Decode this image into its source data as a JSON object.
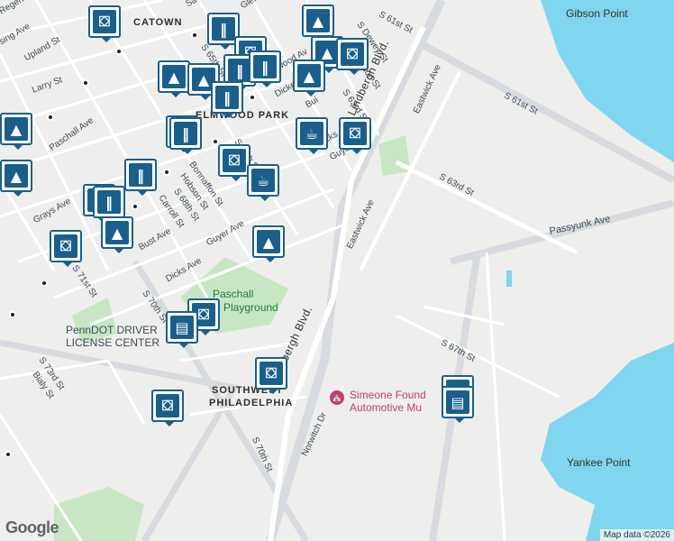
{
  "map": {
    "colors": {
      "land": "#eeeeec",
      "water": "#7fd6ee",
      "park": "#c8e6c4",
      "road": "#ffffff",
      "highway": "#d7dade",
      "marker": "#1a5f8c",
      "poi": "#c43c7a"
    },
    "labels": {
      "gibson_point": "Gibson Point",
      "yankee_point": "Yankee Point",
      "elmwood_park": "ELMWOOD PARK",
      "southwest_philadelphia_1": "SOUTHWEST",
      "southwest_philadelphia_2": "PHILADELPHIA",
      "catown": "CATOWN",
      "paschall_playground_1": "Paschall",
      "paschall_playground_2": "Playground",
      "penndot_1": "PennDOT DRIVER",
      "penndot_2": "LICENSE CENTER",
      "simeone_1": "Simeone Found",
      "simeone_2": "Automotive Mu",
      "s_61st_st_a": "S 61st St",
      "s_61st_st_b": "S 61st St",
      "s_63rd_st_a": "S 63rd St",
      "s_63rd_st_b": "S 63rd St",
      "s_65th_st": "S 65th St",
      "s_66th_st": "S 66th St",
      "s_67th_st": "S 67th St",
      "s_68th_st": "S 68th St",
      "s_70th_st_a": "S 70th St",
      "s_70th_st_b": "S 70th St",
      "s_71st_st": "S 71st St",
      "s_73rd_st": "S 73rd St",
      "s_dewey_st": "S Dewey St",
      "s_robinson_st": "S Robinson St",
      "lindbergh_a": "Lindbergh Blvd.",
      "lindbergh_b": "Lindbergh Blvd.",
      "eastwick_a": "Eastwick Ave",
      "eastwick_b": "Eastwick Ave",
      "passyunk": "Passyunk Ave",
      "upland": "Upland St",
      "larry": "Larry St",
      "paschall_ave": "Paschall Ave",
      "grays": "Grays Ave",
      "bust": "Bust Ave",
      "dicks_a": "Dicks Ave",
      "dicks_b": "Dicks",
      "dicks_c": "Dicke",
      "guyer_a": "Guyer Ave",
      "guyer_b": "Guye",
      "bonnaffon": "Bonnaffon St",
      "hobson": "Hobson St",
      "carroll": "Carroll St",
      "bialy": "Bialy St",
      "norwitch": "Norwitch Dr",
      "glenmore": "Glenmo",
      "regent": "Regent",
      "sing": "sing Ave",
      "sa": "Sa",
      "elmwood_av": "wood Av",
      "bui": "Bui"
    },
    "markers": [
      {
        "kind": "shopping",
        "icon": "shopping-bag-icon",
        "glyph": "⛋"
      },
      {
        "kind": "restaurant",
        "icon": "restaurant-icon",
        "glyph": "‖"
      },
      {
        "kind": "school",
        "icon": "school-icon",
        "glyph": "▲"
      },
      {
        "kind": "cafe",
        "icon": "coffee-cup-icon",
        "glyph": "☕"
      },
      {
        "kind": "grocery",
        "icon": "shopping-cart-icon",
        "glyph": "▤"
      }
    ],
    "attribution": "Map data ©2026",
    "logo": "Google"
  }
}
